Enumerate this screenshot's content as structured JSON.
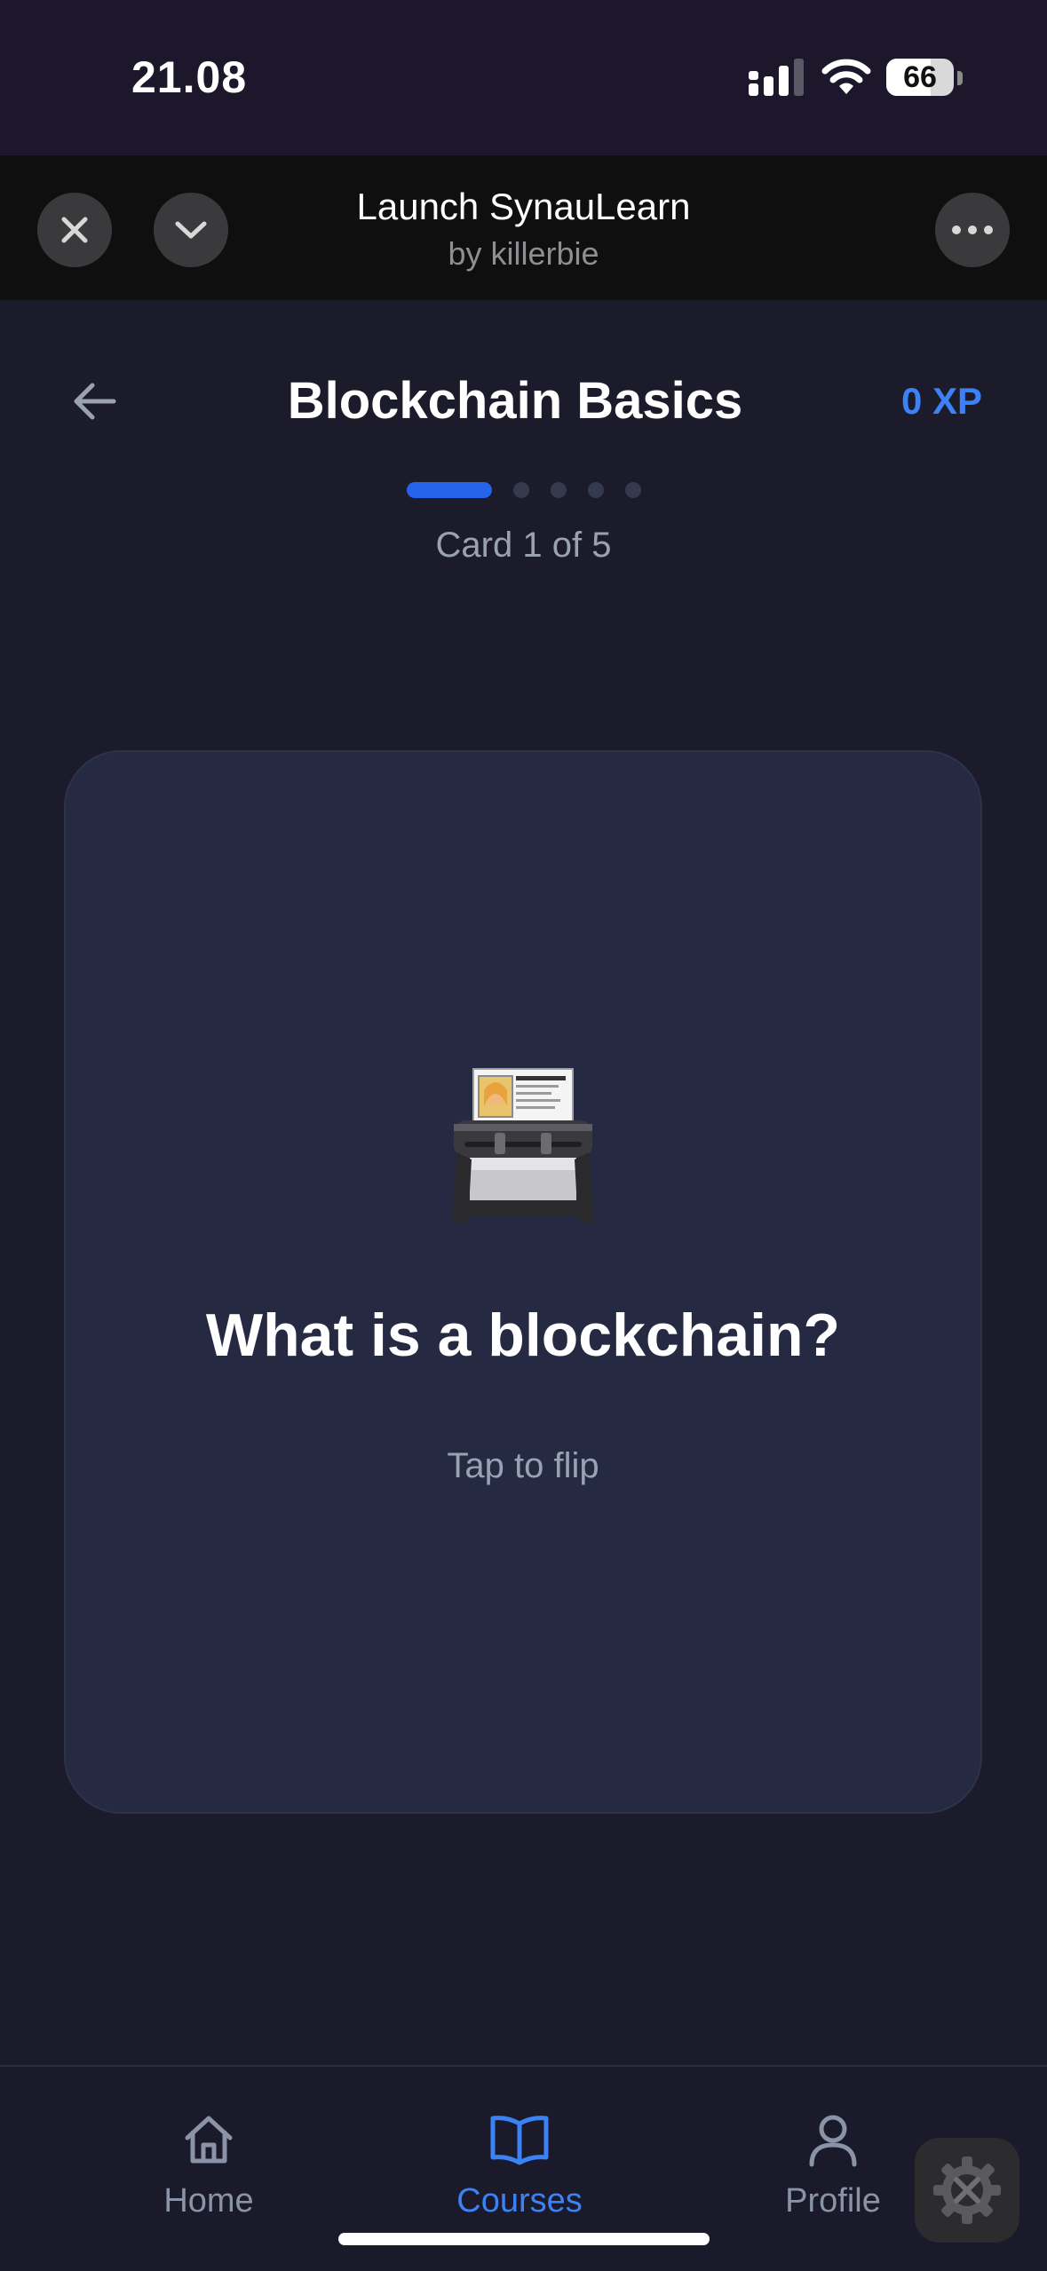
{
  "status_bar": {
    "time": "21.08",
    "battery": "66",
    "battery_level": 0.66
  },
  "mini_app": {
    "title": "Launch SynauLearn",
    "subtitle": "by killerbie",
    "close_icon": "close-icon",
    "collapse_icon": "chevron-down-icon",
    "more_icon": "more-icon"
  },
  "header": {
    "title": "Blockchain Basics",
    "xp": "0 XP",
    "card_counter": "Card 1 of 5",
    "current_card": 1,
    "total_cards": 5
  },
  "card": {
    "icon": "card-file-box-icon",
    "question": "What is a blockchain?",
    "hint": "Tap to flip"
  },
  "nav": {
    "items": [
      {
        "label": "Home",
        "icon": "home-icon",
        "active": false
      },
      {
        "label": "Courses",
        "icon": "book-icon",
        "active": true
      },
      {
        "label": "Profile",
        "icon": "user-icon",
        "active": false
      }
    ]
  },
  "colors": {
    "background": "#1b1b2b",
    "card": "#252a42",
    "accent": "#3b82f6",
    "muted_text": "#9aa1b2"
  }
}
